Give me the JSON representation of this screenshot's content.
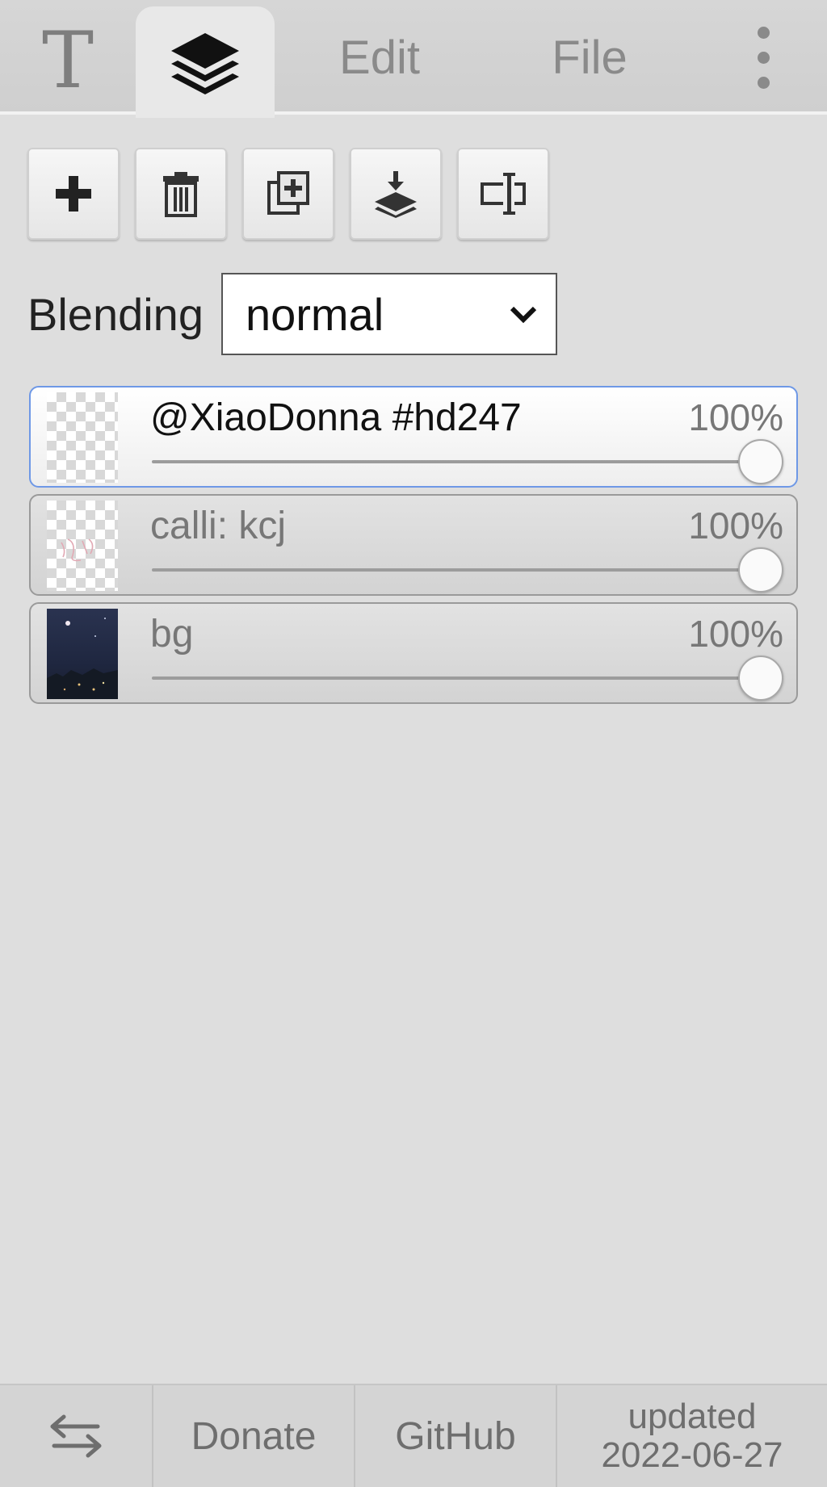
{
  "tabs": {
    "text_glyph": "T",
    "edit_label": "Edit",
    "file_label": "File"
  },
  "toolbar": {
    "buttons": [
      "add-layer-icon",
      "delete-layer-icon",
      "duplicate-layer-icon",
      "merge-down-icon",
      "rename-layer-icon"
    ]
  },
  "blending": {
    "label": "Blending",
    "value": "normal"
  },
  "layers": [
    {
      "name": "@XiaoDonna #hd247",
      "opacity": "100%",
      "opacity_value": 1.0,
      "selected": true,
      "thumbnail": "transparent"
    },
    {
      "name": "calli: kcj",
      "opacity": "100%",
      "opacity_value": 1.0,
      "selected": false,
      "thumbnail": "transparent"
    },
    {
      "name": "bg",
      "opacity": "100%",
      "opacity_value": 1.0,
      "selected": false,
      "thumbnail": "night-photo"
    }
  ],
  "footer": {
    "swap_icon": "swap-arrows-icon",
    "donate_label": "Donate",
    "github_label": "GitHub",
    "updated_line1": "updated",
    "updated_line2": "2022-06-27"
  },
  "colors": {
    "panel_bg": "#dedede",
    "selected_border": "#6e98e6"
  }
}
